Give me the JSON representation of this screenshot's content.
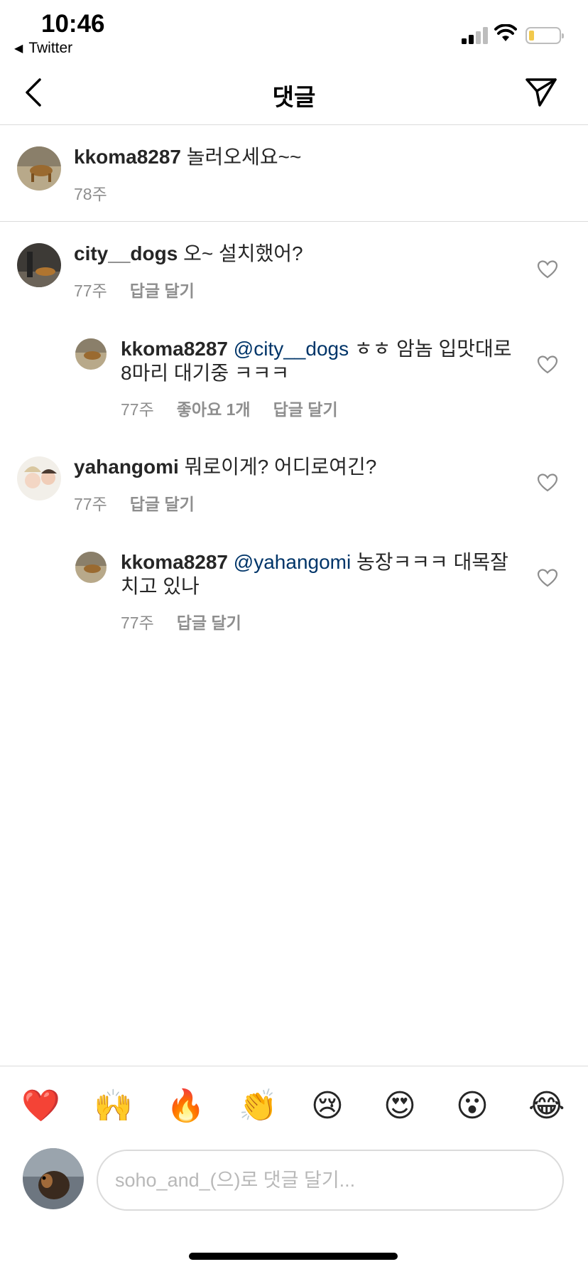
{
  "status_bar": {
    "time": "10:46",
    "back_app": "Twitter",
    "back_arrow": "◀"
  },
  "nav": {
    "title": "댓글",
    "back_icon": "chevron-left-icon",
    "send_icon": "paper-plane-icon"
  },
  "caption": {
    "username": "kkoma8287",
    "text": "놀러오세요~~",
    "time": "78주"
  },
  "comments": [
    {
      "username": "city__dogs",
      "text": "오~ 설치했어?",
      "time": "77주",
      "reply_label": "답글 달기"
    },
    {
      "username": "kkoma8287",
      "mention": "@city__dogs",
      "text_line1": "ㅎㅎ 암놈 입맛대로",
      "text_line2": "8마리 대기중 ㅋㅋㅋ",
      "time": "77주",
      "likes_label": "좋아요 1개",
      "reply_label": "답글 달기"
    },
    {
      "username": "yahangomi",
      "text": "뭐로이게? 어디로여긴?",
      "time": "77주",
      "reply_label": "답글 달기"
    },
    {
      "username": "kkoma8287",
      "mention": "@yahangomi",
      "text_line1": "농장ㅋㅋㅋ 대목잘",
      "text_line2": "치고 있나",
      "time": "77주",
      "reply_label": "답글 달기"
    }
  ],
  "reactions": [
    "❤️",
    "🙌",
    "🔥",
    "👏",
    "😢",
    "😍",
    "😮",
    "😂"
  ],
  "composer": {
    "placeholder": "soho_and_(으)로 댓글 달기..."
  },
  "colors": {
    "text": "#262626",
    "secondary": "#8e8e8e",
    "mention": "#003569",
    "divider": "#dbdbdb"
  }
}
